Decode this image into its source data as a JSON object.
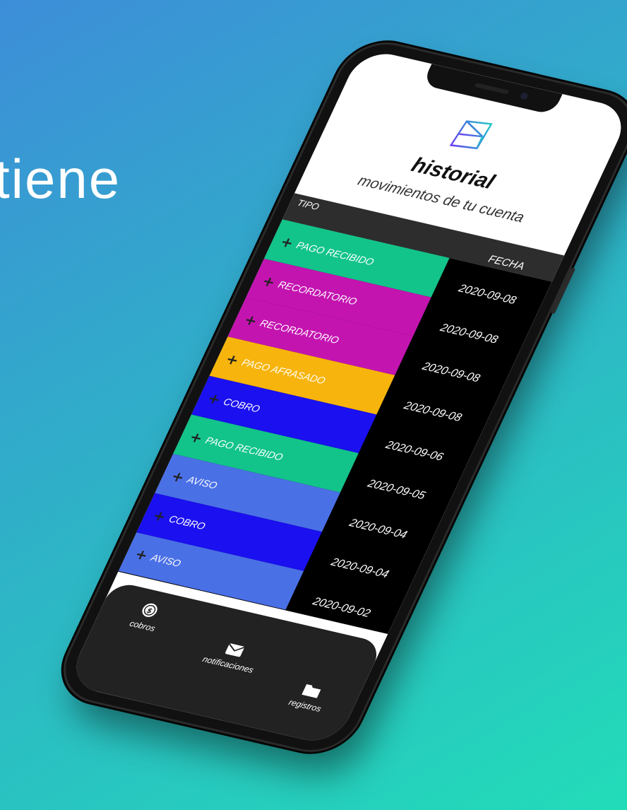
{
  "headline": "tiene",
  "app": {
    "title": "historial",
    "subtitle": "movimientos de tu cuenta",
    "logo_icon": "stacked-frames-logo"
  },
  "table": {
    "col_tipo": "TIPO",
    "col_fecha": "FECHA",
    "plus_symbol": "+",
    "rows": [
      {
        "tipo": "PAGO RECIBIDO",
        "fecha": "2020-09-08",
        "color": "#12c48a"
      },
      {
        "tipo": "RECORDATORIO",
        "fecha": "2020-09-08",
        "color": "#c414b0"
      },
      {
        "tipo": "RECORDATORIO",
        "fecha": "2020-09-08",
        "color": "#c414b0"
      },
      {
        "tipo": "PAGO AFRASADO",
        "fecha": "2020-09-08",
        "color": "#f7b40c"
      },
      {
        "tipo": "COBRO",
        "fecha": "2020-09-06",
        "color": "#1a10f0"
      },
      {
        "tipo": "PAGO RECIBIDO",
        "fecha": "2020-09-05",
        "color": "#12c48a"
      },
      {
        "tipo": "AVISO",
        "fecha": "2020-09-04",
        "color": "#4a70e6"
      },
      {
        "tipo": "COBRO",
        "fecha": "2020-09-04",
        "color": "#1a10f0"
      },
      {
        "tipo": "AVISO",
        "fecha": "2020-09-02",
        "color": "#4a70e6"
      }
    ]
  },
  "tabbar": {
    "items": [
      {
        "label": "cobros",
        "icon": "dollar-coin-icon"
      },
      {
        "label": "notificaciones",
        "icon": "envelope-icon"
      },
      {
        "label": "registros",
        "icon": "folder-icon"
      }
    ]
  },
  "colors": {
    "background_start": "#3d8ed8",
    "background_end": "#22dcb8",
    "pago_recibido": "#12c48a",
    "recordatorio": "#c414b0",
    "pago_afrasado": "#f7b40c",
    "cobro": "#1a10f0",
    "aviso": "#4a70e6"
  }
}
